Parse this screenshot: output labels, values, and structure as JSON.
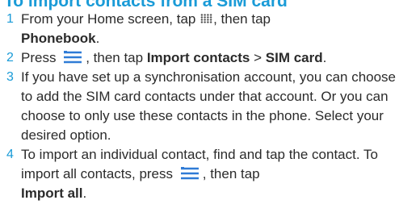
{
  "heading": "To import contacts from a SIM card",
  "colors": {
    "accent": "#1a9bd7",
    "menu_icon": "#2f7bd6",
    "text": "#2b2b2b"
  },
  "icons": {
    "apps": "app-grid-icon",
    "menu": "menu-lines-icon"
  },
  "steps": [
    {
      "num": "1",
      "t1": "From your Home screen, tap",
      "t2": ", then tap",
      "t3": "Phonebook",
      "t4": "."
    },
    {
      "num": "2",
      "t1": "Press",
      "t2": ", then tap",
      "t3": "Import contacts",
      "t4": ">",
      "t5": "SIM card",
      "t6": "."
    },
    {
      "num": "3",
      "text": "If you have set up a synchronisation account, you can choose to add the SIM card contacts under that account. Or you can choose to only use these contacts in the phone. Select your desired option."
    },
    {
      "num": "4",
      "t1": "To import an individual contact, find and tap the contact. To import all contacts, press",
      "t2": ", then tap",
      "t3": "Import all",
      "t4": "."
    }
  ]
}
